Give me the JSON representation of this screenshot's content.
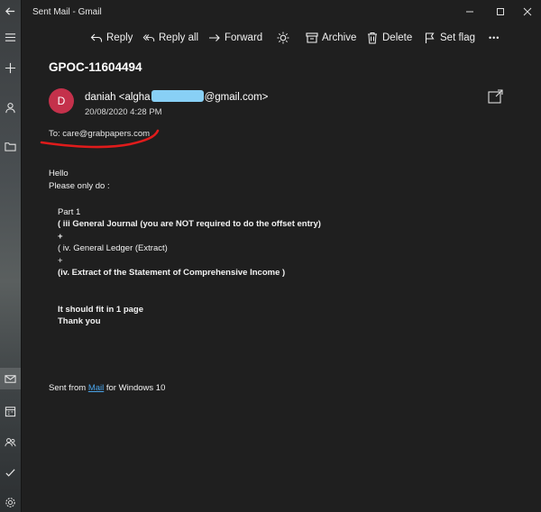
{
  "window": {
    "title": "Sent Mail - Gmail"
  },
  "toolbar": {
    "reply": "Reply",
    "reply_all": "Reply all",
    "forward": "Forward",
    "archive": "Archive",
    "delete": "Delete",
    "set_flag": "Set flag",
    "more": "•••"
  },
  "message": {
    "subject": "GPOC-11604494",
    "avatar_initial": "D",
    "sender_prefix": "daniah <algha",
    "sender_suffix": "@gmail.com>",
    "date": "20/08/2020 4:28 PM",
    "to": "To: care@grabpapers.com",
    "body": {
      "greeting": "Hello",
      "line2": "Please only do :",
      "part": "Part 1",
      "item1": "( iii General Journal (you are NOT required to do the offset entry)",
      "plus1": "+",
      "item2": "( iv. General Ledger (Extract)",
      "plus2": "+",
      "item3": "(iv.  Extract of the Statement of Comprehensive Income )",
      "note1": "It should fit in 1 page",
      "note2": "Thank you"
    },
    "footer_prefix": "Sent from ",
    "footer_link": "Mail",
    "footer_suffix": " for Windows 10"
  },
  "colors": {
    "background": "#1f1f1f",
    "avatar": "#c4314b",
    "link": "#4aa3e8",
    "redaction": "#88d0f5",
    "annotation": "#e01b1b"
  }
}
